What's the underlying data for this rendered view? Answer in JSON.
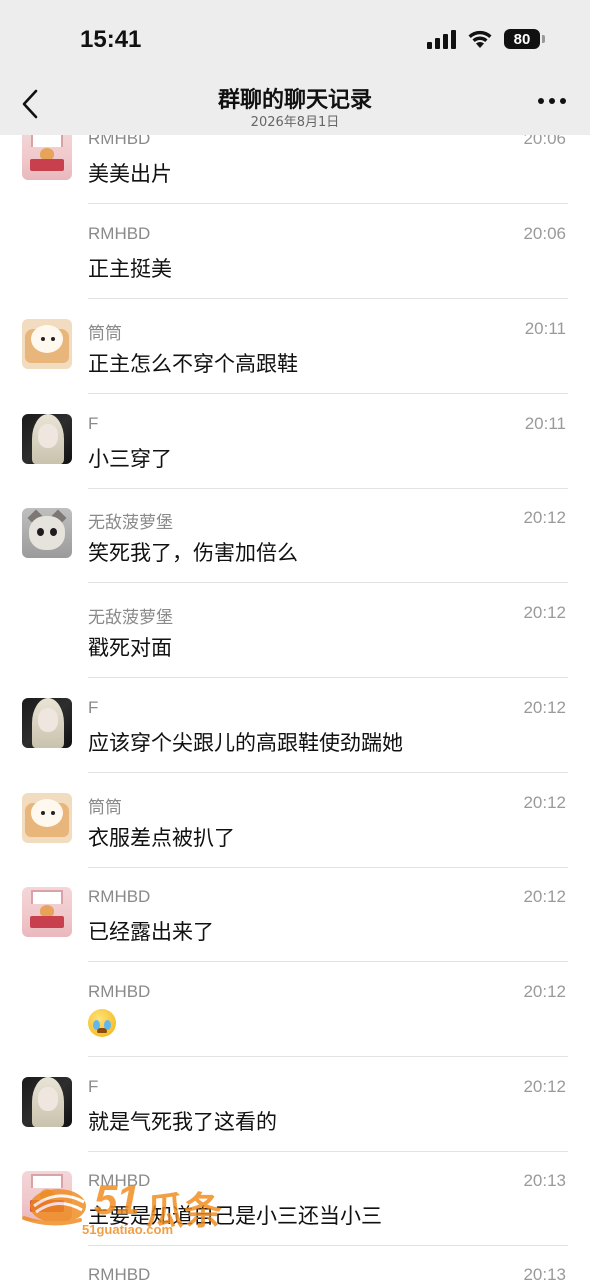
{
  "status_bar": {
    "time": "15:41",
    "battery": "80"
  },
  "nav": {
    "title": "群聊的聊天记录",
    "subtitle": "2026年8月1日"
  },
  "messages": [
    {
      "sender": "RMHBD",
      "time": "20:06",
      "text": "美美出片",
      "avatar": "rmhbd"
    },
    {
      "sender": "RMHBD",
      "time": "20:06",
      "text": "正主挺美",
      "avatar": null
    },
    {
      "sender": "筒筒",
      "time": "20:11",
      "text": "正主怎么不穿个高跟鞋",
      "avatar": "tongtong"
    },
    {
      "sender": "F",
      "time": "20:11",
      "text": "小三穿了",
      "avatar": "f"
    },
    {
      "sender": "无敌菠萝堡",
      "time": "20:12",
      "text": "笑死我了，伤害加倍么",
      "avatar": "wudi"
    },
    {
      "sender": "无敌菠萝堡",
      "time": "20:12",
      "text": "戳死对面",
      "avatar": null
    },
    {
      "sender": "F",
      "time": "20:12",
      "text": "应该穿个尖跟儿的高跟鞋使劲踹她",
      "avatar": "f"
    },
    {
      "sender": "筒筒",
      "time": "20:12",
      "text": "衣服差点被扒了",
      "avatar": "tongtong"
    },
    {
      "sender": "RMHBD",
      "time": "20:12",
      "text": "已经露出来了",
      "avatar": "rmhbd"
    },
    {
      "sender": "RMHBD",
      "time": "20:12",
      "text": "",
      "emoji": "crying-face",
      "avatar": null
    },
    {
      "sender": "F",
      "time": "20:12",
      "text": "就是气死我了这看的",
      "avatar": "f"
    },
    {
      "sender": "RMHBD",
      "time": "20:13",
      "text": "主要是知道自己是小三还当小三",
      "avatar": "rmhbd"
    },
    {
      "sender": "RMHBD",
      "time": "20:13",
      "text": "",
      "avatar": null
    }
  ],
  "watermark": {
    "number": "51",
    "chinese": "瓜条",
    "url": "51guatiao.com"
  },
  "colors": {
    "header_bg": "#ededed",
    "divider": "#e3e3e3",
    "meta_text": "#8a8a8a",
    "watermark": "#f08a1c"
  }
}
